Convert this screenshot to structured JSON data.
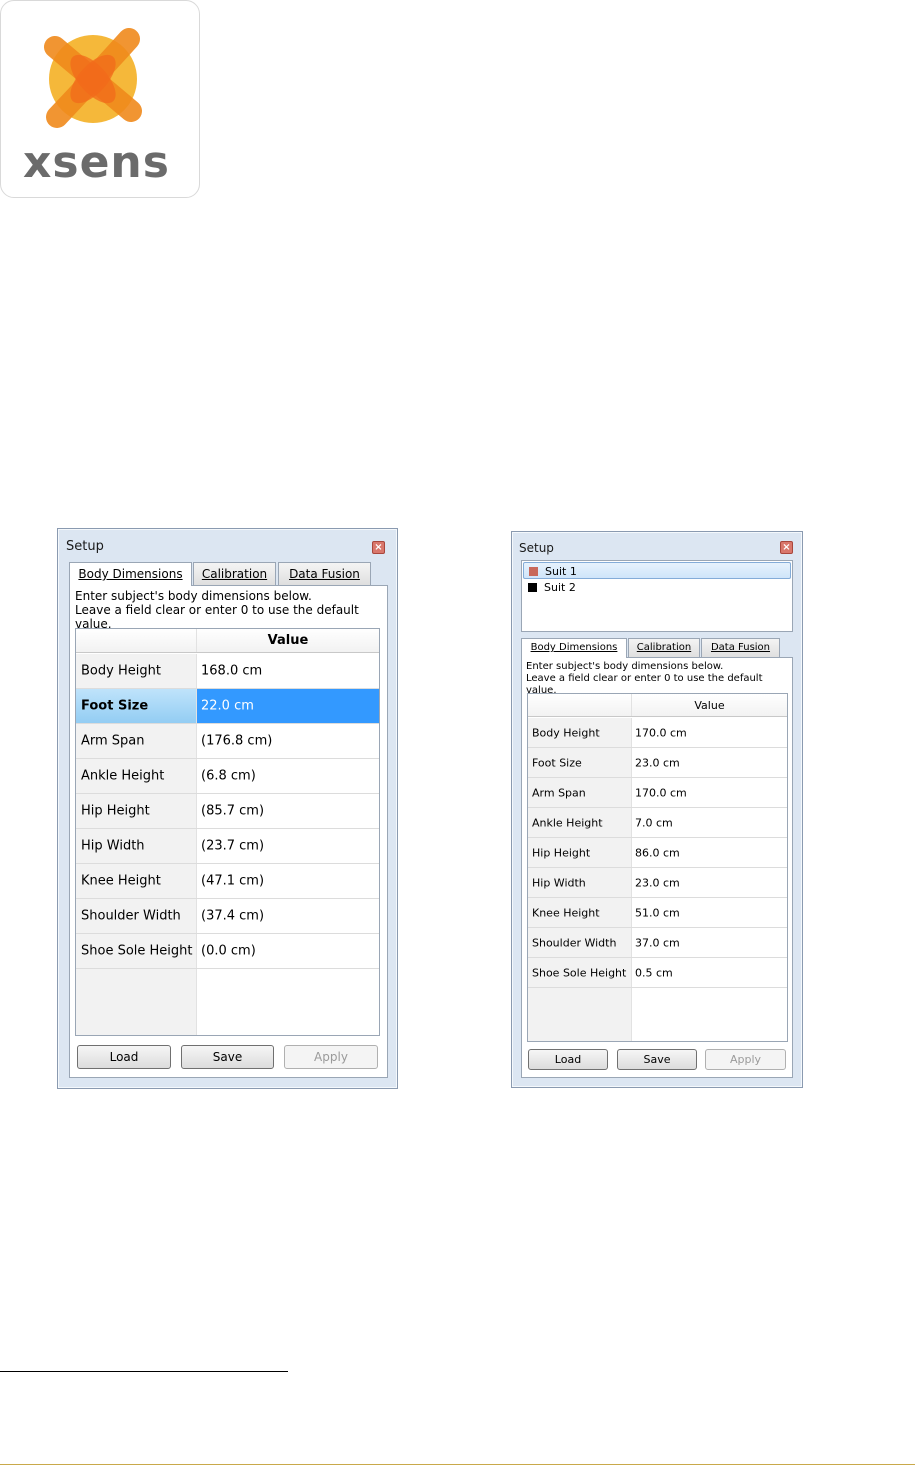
{
  "logo": {
    "word": "xsens",
    "colors": {
      "orange": "#f08a1c",
      "gold": "#f5b83a",
      "gray": "#6b6b6b"
    }
  },
  "dialog_a": {
    "title": "Setup",
    "tabs": [
      "Body Dimensions",
      "Calibration",
      "Data Fusion"
    ],
    "active_tab": 0,
    "help_line1": "Enter subject's body dimensions below.",
    "help_line2": "Leave a field clear or enter 0 to use the default value.",
    "value_header": "Value",
    "rows": [
      {
        "name": "Body Height",
        "value": "168.0 cm"
      },
      {
        "name": "Foot Size",
        "value": "22.0 cm",
        "selected": true
      },
      {
        "name": "Arm Span",
        "value": "(176.8 cm)"
      },
      {
        "name": "Ankle Height",
        "value": "(6.8 cm)"
      },
      {
        "name": "Hip Height",
        "value": "(85.7 cm)"
      },
      {
        "name": "Hip Width",
        "value": "(23.7 cm)"
      },
      {
        "name": "Knee Height",
        "value": "(47.1 cm)"
      },
      {
        "name": "Shoulder Width",
        "value": "(37.4 cm)"
      },
      {
        "name": "Shoe Sole Height",
        "value": "(0.0 cm)"
      }
    ],
    "buttons": {
      "load": "Load",
      "save": "Save",
      "apply": "Apply"
    }
  },
  "dialog_b": {
    "title": "Setup",
    "suits": [
      {
        "name": "Suit 1",
        "color": "#c8685a",
        "selected": true
      },
      {
        "name": "Suit 2",
        "color": "#000000",
        "selected": false
      }
    ],
    "tabs": [
      "Body Dimensions",
      "Calibration",
      "Data Fusion"
    ],
    "active_tab": 0,
    "help_line1": "Enter subject's body dimensions below.",
    "help_line2": "Leave a field clear or enter 0 to use the default value.",
    "value_header": "Value",
    "rows": [
      {
        "name": "Body Height",
        "value": "170.0 cm"
      },
      {
        "name": "Foot Size",
        "value": "23.0 cm"
      },
      {
        "name": "Arm Span",
        "value": "170.0 cm"
      },
      {
        "name": "Ankle Height",
        "value": "7.0 cm"
      },
      {
        "name": "Hip Height",
        "value": "86.0 cm"
      },
      {
        "name": "Hip Width",
        "value": "23.0 cm"
      },
      {
        "name": "Knee Height",
        "value": "51.0 cm"
      },
      {
        "name": "Shoulder Width",
        "value": "37.0 cm"
      },
      {
        "name": "Shoe Sole Height",
        "value": "0.5 cm"
      }
    ],
    "buttons": {
      "load": "Load",
      "save": "Save",
      "apply": "Apply"
    }
  }
}
